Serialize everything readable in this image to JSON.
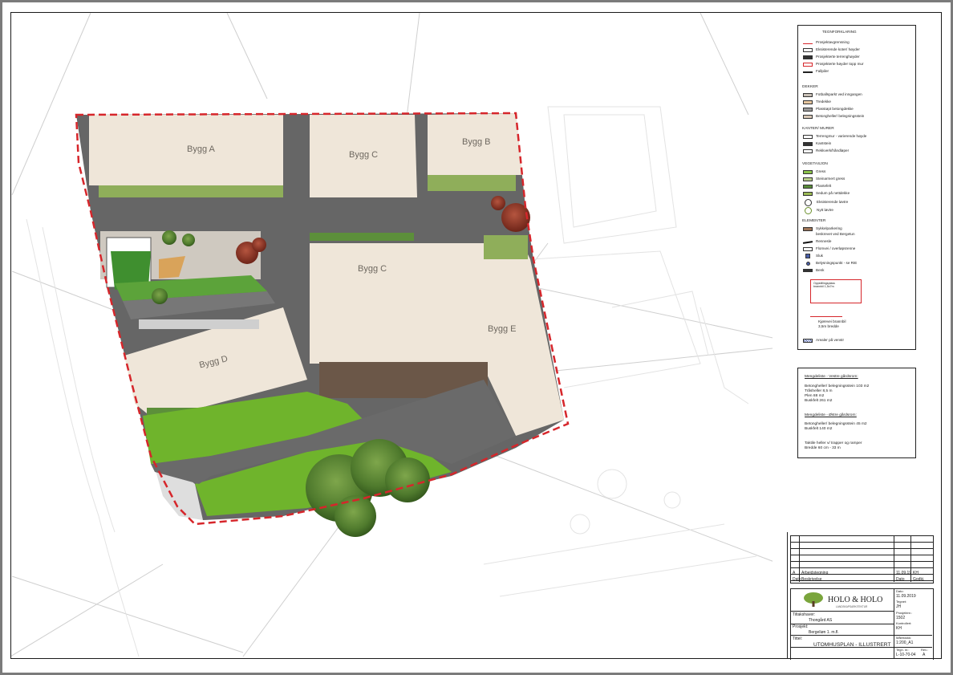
{
  "plan": {
    "buildings": [
      "Bygg A",
      "Bygg C",
      "Bygg B",
      "Bygg C",
      "Bygg E",
      "Bygg D"
    ]
  },
  "legend": {
    "title": "TEGNFORKLARING",
    "groups": [
      {
        "heading": "",
        "items": [
          {
            "label": "Prosjektavgrensning",
            "swatch": "line-red"
          },
          {
            "label": "Eksisterende koter/ høyder",
            "swatch": "box-white"
          },
          {
            "label": "Prosjekterte terrenghøyder",
            "swatch": "box-dark"
          },
          {
            "label": "Prosjekterte høyder topp mur",
            "swatch": "box-red"
          },
          {
            "label": "Fallpiler",
            "swatch": "arrow"
          }
        ]
      },
      {
        "heading": "DEKKER",
        "items": [
          {
            "label": "Fotballsparkt ved inngangen",
            "swatch": "#c8c0b6"
          },
          {
            "label": "Tredekke",
            "swatch": "#e7c7a0"
          },
          {
            "label": "Plasstøpt betongdekke",
            "swatch": "#9a9a9a"
          },
          {
            "label": "Betongheller/ belegningsstein",
            "swatch": "#d9c9b8"
          }
        ]
      },
      {
        "heading": "KANTER/ MURER",
        "items": [
          {
            "label": "Terrengmur - varierende høyde",
            "swatch": "box-white"
          },
          {
            "label": "Kantstein",
            "swatch": "box-dark"
          },
          {
            "label": "Rekkverk/håndløper",
            "swatch": "box-white"
          }
        ]
      },
      {
        "heading": "VEGETASJON",
        "items": [
          {
            "label": "Gress",
            "swatch": "#8bc34a"
          },
          {
            "label": "Steinarmert gress",
            "swatch": "#b9cf8a"
          },
          {
            "label": "Plantefelt",
            "swatch": "#5a8d3a"
          },
          {
            "label": "Sedum på nettdekke",
            "swatch": "#9bbb55"
          },
          {
            "label": "Eksisterende løvtre",
            "swatch": "circle"
          },
          {
            "label": "Nytt løvtre",
            "swatch": "circle-plus"
          }
        ]
      },
      {
        "heading": "ELEMENTER",
        "items": [
          {
            "label": "Sykkelparkering",
            "swatch": "#a0775a"
          },
          {
            "label": "beskrevet ved Bergetun",
            "swatch": ""
          },
          {
            "label": "Rennesle",
            "swatch": "line-black"
          },
          {
            "label": "Flomvei / overløpsrenne",
            "swatch": "box-white"
          },
          {
            "label": "Sluk",
            "swatch": "#4a5fa8"
          },
          {
            "label": "Belysningspunkt - se RIE",
            "swatch": "#4a5fa8"
          },
          {
            "label": "Benk",
            "swatch": "#333333"
          }
        ]
      }
    ],
    "note_box": "Oppstillingsplass brannbil 1,5x7m",
    "fire_lines": [
      "Kjørevei brannbil",
      "3,5m bredde"
    ],
    "areas_text": "Arealer på venstr"
  },
  "quantities": {
    "group1_title": "Mengdeliste - Vestre gårdsrom:",
    "group1": [
      "Betongheller/ belegningsstein 103 m2",
      "Tråsheller 8,5 m",
      "Plen 88 m2",
      "Buskfelt 261 m2"
    ],
    "group2_title": "Mengdeliste - Østre gårdsrom:",
    "group2": [
      "Betongheller/ belegningsstein 45 m2",
      "Buskfelt 140 m2"
    ],
    "group3": [
      "Taktile heller v/ trapper og ramper",
      "Bredde 60 cm - 33 m"
    ]
  },
  "title_block": {
    "revision": {
      "letter": "A",
      "text": "Arbeidstegning",
      "date": "11.09.19",
      "sign": "KH"
    },
    "rev_headers": {
      "dato": "Dato",
      "beskrivelse": "Beskrivelse",
      "dato2": "Dato",
      "godkj": "Godkj."
    },
    "company": "HOLO & HOLO",
    "company_sub": "LANDSKAPSARKITEKTUR",
    "tiltakshaver_label": "Tiltakshaver:",
    "tiltakshaver": "Thongård AS",
    "prosjekt_label": "Prosjekt:",
    "prosjekt": "Bergeliøn 1. m.fl.",
    "tittel_label": "Tittel:",
    "tittel": "UTOMHUSPLAN - ILLUSTRERT",
    "dato_label": "Dato:",
    "dato": "11.09.2019",
    "tegnet_label": "Tegnet:",
    "tegnet": "JH",
    "prosjektnr_label": "Prosjektnr.:",
    "prosjektnr": "1502",
    "kontrollert_label": "Kontrollert:",
    "kontrollert": "KH",
    "malestokk_label": "Målestokk:",
    "malestokk": "1:200_A1",
    "tegnnr_label": "Tegn. nr.:",
    "tegnnr": "L-10-70-04",
    "rev_label": "Rev.:",
    "rev": "A"
  },
  "colors": {
    "building": "#efe6d9",
    "asphalt": "#626262",
    "grass": "#6fb42c",
    "boundary": "#d6262b"
  }
}
